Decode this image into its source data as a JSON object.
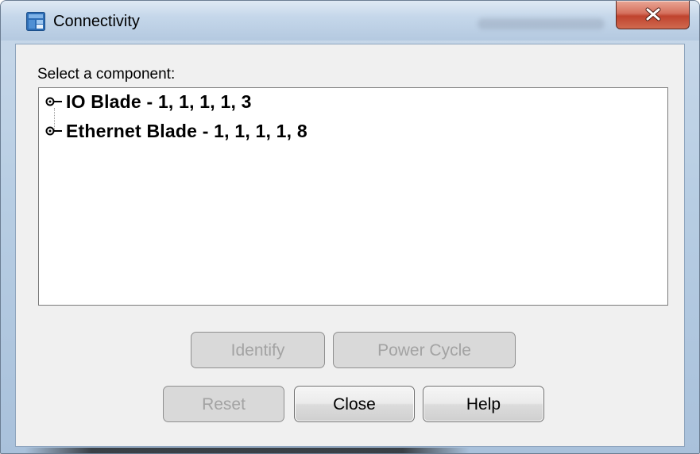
{
  "window": {
    "title": "Connectivity",
    "app_icon": "app-icon",
    "close_icon": "close-icon"
  },
  "prompt": {
    "label": "Select a component:"
  },
  "tree": {
    "items": [
      {
        "label": "IO Blade - 1, 1, 1, 1, 3",
        "icon": "tree-expander-icon",
        "selected": false
      },
      {
        "label": "Ethernet Blade - 1, 1, 1, 1, 8",
        "icon": "tree-expander-icon",
        "selected": false
      }
    ]
  },
  "buttons": {
    "identify": {
      "label": "Identify",
      "enabled": false
    },
    "power_cycle": {
      "label": "Power Cycle",
      "enabled": false
    },
    "reset": {
      "label": "Reset",
      "enabled": false
    },
    "close": {
      "label": "Close",
      "enabled": true
    },
    "help": {
      "label": "Help",
      "enabled": true
    }
  },
  "colors": {
    "title_bar": "#c5d7ea",
    "close_button": "#c8503a",
    "client_background": "#f0f0f0",
    "disabled_text": "#a3a3a3"
  }
}
